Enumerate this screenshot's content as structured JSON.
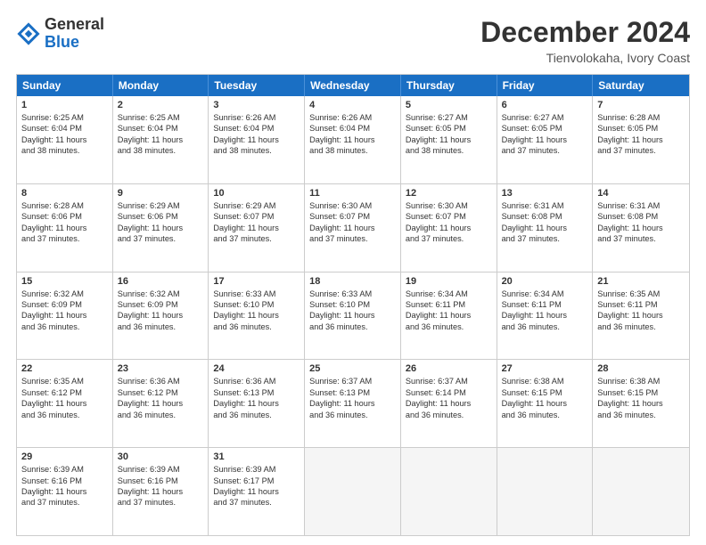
{
  "header": {
    "logo_general": "General",
    "logo_blue": "Blue",
    "month": "December 2024",
    "location": "Tienvolokaha, Ivory Coast"
  },
  "days_of_week": [
    "Sunday",
    "Monday",
    "Tuesday",
    "Wednesday",
    "Thursday",
    "Friday",
    "Saturday"
  ],
  "weeks": [
    [
      {
        "day": "1",
        "info": "Sunrise: 6:25 AM\nSunset: 6:04 PM\nDaylight: 11 hours\nand 38 minutes."
      },
      {
        "day": "2",
        "info": "Sunrise: 6:25 AM\nSunset: 6:04 PM\nDaylight: 11 hours\nand 38 minutes."
      },
      {
        "day": "3",
        "info": "Sunrise: 6:26 AM\nSunset: 6:04 PM\nDaylight: 11 hours\nand 38 minutes."
      },
      {
        "day": "4",
        "info": "Sunrise: 6:26 AM\nSunset: 6:04 PM\nDaylight: 11 hours\nand 38 minutes."
      },
      {
        "day": "5",
        "info": "Sunrise: 6:27 AM\nSunset: 6:05 PM\nDaylight: 11 hours\nand 38 minutes."
      },
      {
        "day": "6",
        "info": "Sunrise: 6:27 AM\nSunset: 6:05 PM\nDaylight: 11 hours\nand 37 minutes."
      },
      {
        "day": "7",
        "info": "Sunrise: 6:28 AM\nSunset: 6:05 PM\nDaylight: 11 hours\nand 37 minutes."
      }
    ],
    [
      {
        "day": "8",
        "info": "Sunrise: 6:28 AM\nSunset: 6:06 PM\nDaylight: 11 hours\nand 37 minutes."
      },
      {
        "day": "9",
        "info": "Sunrise: 6:29 AM\nSunset: 6:06 PM\nDaylight: 11 hours\nand 37 minutes."
      },
      {
        "day": "10",
        "info": "Sunrise: 6:29 AM\nSunset: 6:07 PM\nDaylight: 11 hours\nand 37 minutes."
      },
      {
        "day": "11",
        "info": "Sunrise: 6:30 AM\nSunset: 6:07 PM\nDaylight: 11 hours\nand 37 minutes."
      },
      {
        "day": "12",
        "info": "Sunrise: 6:30 AM\nSunset: 6:07 PM\nDaylight: 11 hours\nand 37 minutes."
      },
      {
        "day": "13",
        "info": "Sunrise: 6:31 AM\nSunset: 6:08 PM\nDaylight: 11 hours\nand 37 minutes."
      },
      {
        "day": "14",
        "info": "Sunrise: 6:31 AM\nSunset: 6:08 PM\nDaylight: 11 hours\nand 37 minutes."
      }
    ],
    [
      {
        "day": "15",
        "info": "Sunrise: 6:32 AM\nSunset: 6:09 PM\nDaylight: 11 hours\nand 36 minutes."
      },
      {
        "day": "16",
        "info": "Sunrise: 6:32 AM\nSunset: 6:09 PM\nDaylight: 11 hours\nand 36 minutes."
      },
      {
        "day": "17",
        "info": "Sunrise: 6:33 AM\nSunset: 6:10 PM\nDaylight: 11 hours\nand 36 minutes."
      },
      {
        "day": "18",
        "info": "Sunrise: 6:33 AM\nSunset: 6:10 PM\nDaylight: 11 hours\nand 36 minutes."
      },
      {
        "day": "19",
        "info": "Sunrise: 6:34 AM\nSunset: 6:11 PM\nDaylight: 11 hours\nand 36 minutes."
      },
      {
        "day": "20",
        "info": "Sunrise: 6:34 AM\nSunset: 6:11 PM\nDaylight: 11 hours\nand 36 minutes."
      },
      {
        "day": "21",
        "info": "Sunrise: 6:35 AM\nSunset: 6:11 PM\nDaylight: 11 hours\nand 36 minutes."
      }
    ],
    [
      {
        "day": "22",
        "info": "Sunrise: 6:35 AM\nSunset: 6:12 PM\nDaylight: 11 hours\nand 36 minutes."
      },
      {
        "day": "23",
        "info": "Sunrise: 6:36 AM\nSunset: 6:12 PM\nDaylight: 11 hours\nand 36 minutes."
      },
      {
        "day": "24",
        "info": "Sunrise: 6:36 AM\nSunset: 6:13 PM\nDaylight: 11 hours\nand 36 minutes."
      },
      {
        "day": "25",
        "info": "Sunrise: 6:37 AM\nSunset: 6:13 PM\nDaylight: 11 hours\nand 36 minutes."
      },
      {
        "day": "26",
        "info": "Sunrise: 6:37 AM\nSunset: 6:14 PM\nDaylight: 11 hours\nand 36 minutes."
      },
      {
        "day": "27",
        "info": "Sunrise: 6:38 AM\nSunset: 6:15 PM\nDaylight: 11 hours\nand 36 minutes."
      },
      {
        "day": "28",
        "info": "Sunrise: 6:38 AM\nSunset: 6:15 PM\nDaylight: 11 hours\nand 36 minutes."
      }
    ],
    [
      {
        "day": "29",
        "info": "Sunrise: 6:39 AM\nSunset: 6:16 PM\nDaylight: 11 hours\nand 37 minutes."
      },
      {
        "day": "30",
        "info": "Sunrise: 6:39 AM\nSunset: 6:16 PM\nDaylight: 11 hours\nand 37 minutes."
      },
      {
        "day": "31",
        "info": "Sunrise: 6:39 AM\nSunset: 6:17 PM\nDaylight: 11 hours\nand 37 minutes."
      },
      {
        "day": "",
        "info": ""
      },
      {
        "day": "",
        "info": ""
      },
      {
        "day": "",
        "info": ""
      },
      {
        "day": "",
        "info": ""
      }
    ]
  ]
}
